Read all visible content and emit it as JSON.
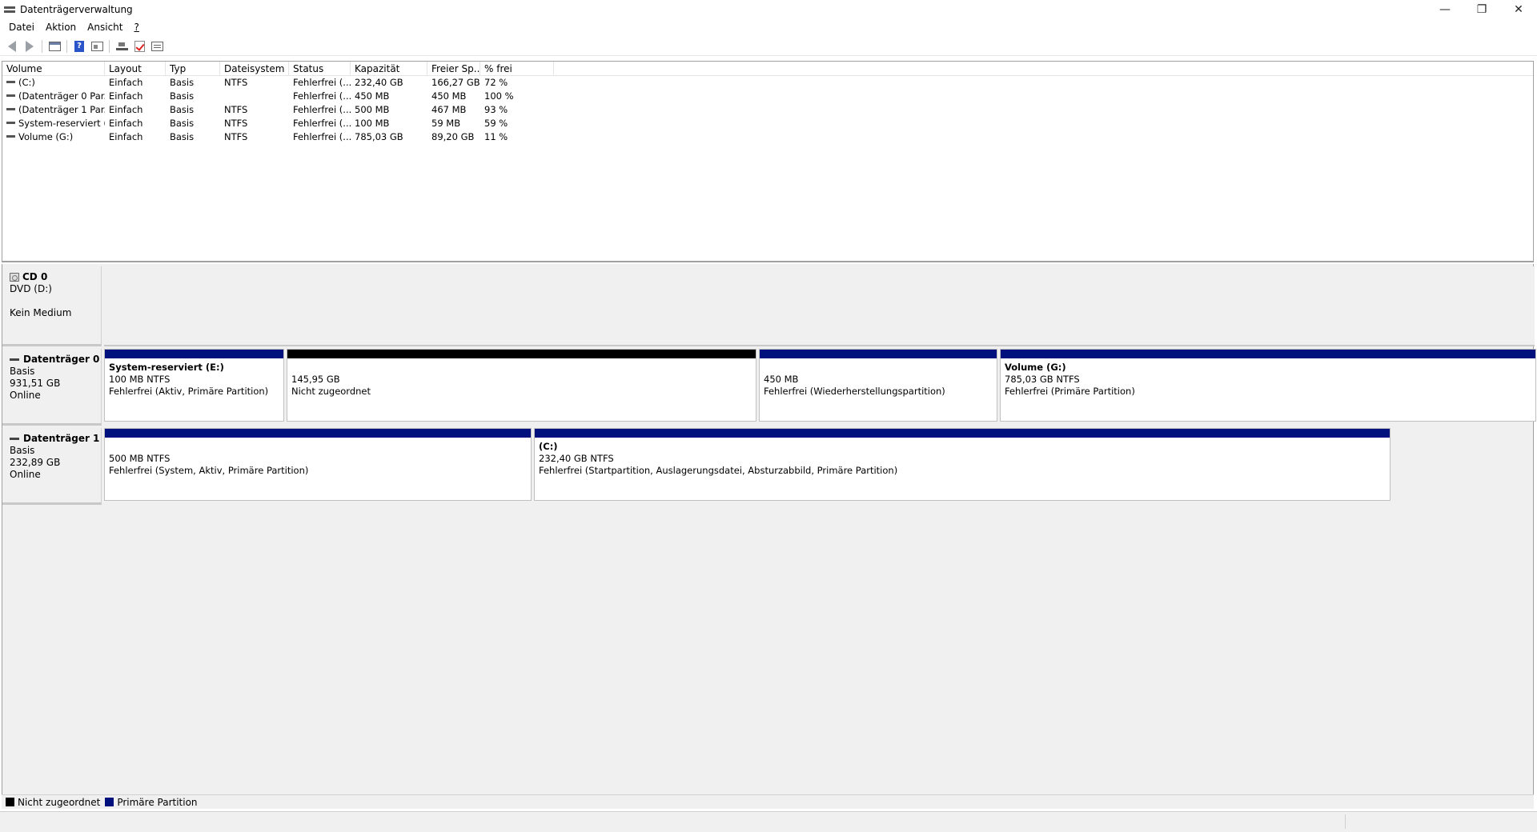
{
  "window": {
    "title": "Datenträgerverwaltung",
    "controls": {
      "minimize": "—",
      "restore": "❐",
      "close": "✕"
    }
  },
  "menu": [
    {
      "label": "Datei",
      "accel": "D"
    },
    {
      "label": "Aktion",
      "accel": "k"
    },
    {
      "label": "Ansicht",
      "accel": "A"
    },
    {
      "label": "?",
      "accel": "?"
    }
  ],
  "toolbar": {
    "icons": [
      "back-icon",
      "forward-icon",
      "console-tree-icon",
      "help-icon",
      "properties-icon",
      "connect-disk-icon",
      "rescan-icon",
      "list-view-icon"
    ],
    "help_glyph": "?"
  },
  "volume_list": {
    "columns": [
      "Volume",
      "Layout",
      "Typ",
      "Dateisystem",
      "Status",
      "Kapazität",
      "Freier Sp...",
      "% frei"
    ],
    "rows": [
      [
        "(C:)",
        "Einfach",
        "Basis",
        "NTFS",
        "Fehlerfrei (...",
        "232,40 GB",
        "166,27 GB",
        "72 %"
      ],
      [
        "(Datenträger 0 Par...",
        "Einfach",
        "Basis",
        "",
        "Fehlerfrei (...",
        "450 MB",
        "450 MB",
        "100 %"
      ],
      [
        "(Datenträger 1 Par...",
        "Einfach",
        "Basis",
        "NTFS",
        "Fehlerfrei (...",
        "500 MB",
        "467 MB",
        "93 %"
      ],
      [
        "System-reserviert (...",
        "Einfach",
        "Basis",
        "NTFS",
        "Fehlerfrei (...",
        "100 MB",
        "59 MB",
        "59 %"
      ],
      [
        "Volume (G:)",
        "Einfach",
        "Basis",
        "NTFS",
        "Fehlerfrei (...",
        "785,03 GB",
        "89,20 GB",
        "11 %"
      ]
    ]
  },
  "disks": {
    "cd0": {
      "name": "CD 0",
      "type": "DVD (D:)",
      "media": "Kein Medium"
    },
    "disk0": {
      "name": "Datenträger 0",
      "type": "Basis",
      "size": "931,51 GB",
      "state": "Online",
      "partitions": [
        {
          "name": "System-reserviert  (E:)",
          "size": "100 MB NTFS",
          "status": "Fehlerfrei (Aktiv, Primäre Partition)"
        },
        {
          "name": "",
          "size": "145,95 GB",
          "status": "Nicht zugeordnet"
        },
        {
          "name": "",
          "size": "450 MB",
          "status": "Fehlerfrei (Wiederherstellungspartition)"
        },
        {
          "name": "Volume  (G:)",
          "size": "785,03 GB NTFS",
          "status": "Fehlerfrei (Primäre Partition)"
        }
      ]
    },
    "disk1": {
      "name": "Datenträger 1",
      "type": "Basis",
      "size": "232,89 GB",
      "state": "Online",
      "partitions": [
        {
          "name": "",
          "size": "500 MB NTFS",
          "status": "Fehlerfrei (System, Aktiv, Primäre Partition)"
        },
        {
          "name": " (C:)",
          "size": "232,40 GB NTFS",
          "status": "Fehlerfrei (Startpartition, Auslagerungsdatei, Absturzabbild, Primäre Partition)"
        }
      ]
    }
  },
  "legend": [
    {
      "label": "Nicht zugeordnet",
      "color": "#000000"
    },
    {
      "label": "Primäre Partition",
      "color": "#00107c"
    }
  ],
  "colors": {
    "primary_partition": "#00107c",
    "unallocated": "#000000",
    "background": "#f0f0f0"
  }
}
